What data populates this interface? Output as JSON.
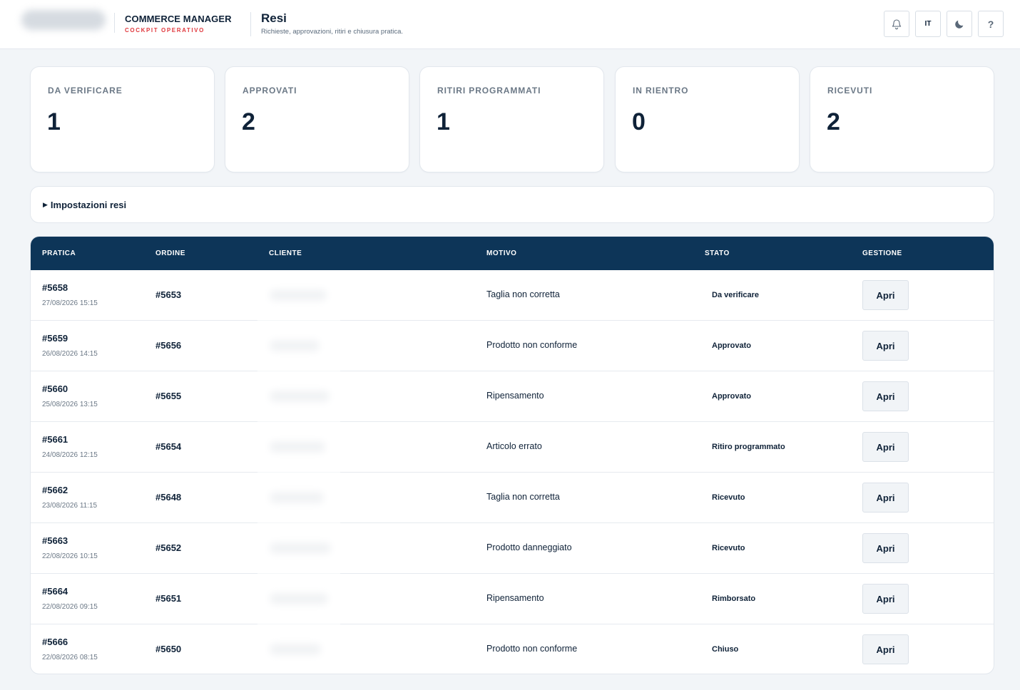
{
  "header": {
    "brand_title": "COMMERCE MANAGER",
    "brand_subtitle": "COCKPIT OPERATIVO",
    "page_title": "Resi",
    "page_subtitle": "Richieste, approvazioni, ritiri e chiusura pratica.",
    "language": "IT",
    "help_label": "?",
    "icons": [
      "bell-icon",
      "moon-icon"
    ]
  },
  "kpis": [
    {
      "label": "DA VERIFICARE",
      "value": "1"
    },
    {
      "label": "APPROVATI",
      "value": "2"
    },
    {
      "label": "RITIRI PROGRAMMATI",
      "value": "1"
    },
    {
      "label": "IN RIENTRO",
      "value": "0"
    },
    {
      "label": "RICEVUTI",
      "value": "2"
    }
  ],
  "settings": {
    "label": "Impostazioni resi",
    "toggle_glyph": "▶"
  },
  "table": {
    "columns": [
      "PRATICA",
      "ORDINE",
      "CLIENTE",
      "MOTIVO",
      "STATO",
      "GESTIONE"
    ],
    "action_label": "Apri",
    "rows": [
      {
        "pratica": "#5658",
        "date": "27/08/2026 15:15",
        "ordine": "#5653",
        "motivo": "Taglia non corretta",
        "stato": "Da verificare"
      },
      {
        "pratica": "#5659",
        "date": "26/08/2026 14:15",
        "ordine": "#5656",
        "motivo": "Prodotto non conforme",
        "stato": "Approvato"
      },
      {
        "pratica": "#5660",
        "date": "25/08/2026 13:15",
        "ordine": "#5655",
        "motivo": "Ripensamento",
        "stato": "Approvato"
      },
      {
        "pratica": "#5661",
        "date": "24/08/2026 12:15",
        "ordine": "#5654",
        "motivo": "Articolo errato",
        "stato": "Ritiro programmato"
      },
      {
        "pratica": "#5662",
        "date": "23/08/2026 11:15",
        "ordine": "#5648",
        "motivo": "Taglia non corretta",
        "stato": "Ricevuto"
      },
      {
        "pratica": "#5663",
        "date": "22/08/2026 10:15",
        "ordine": "#5652",
        "motivo": "Prodotto danneggiato",
        "stato": "Ricevuto"
      },
      {
        "pratica": "#5664",
        "date": "22/08/2026 09:15",
        "ordine": "#5651",
        "motivo": "Ripensamento",
        "stato": "Rimborsato"
      },
      {
        "pratica": "#5666",
        "date": "22/08/2026 08:15",
        "ordine": "#5650",
        "motivo": "Prodotto non conforme",
        "stato": "Chiuso"
      }
    ]
  },
  "colors": {
    "accent": "#0d3558",
    "brand_red": "#e0393e",
    "background": "#f2f5f8"
  }
}
